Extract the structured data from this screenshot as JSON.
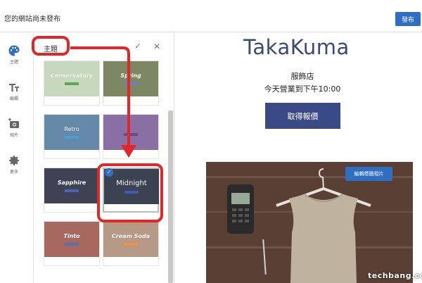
{
  "topbar": {
    "site_status": "您的網站尚未發布",
    "publish_label": "發布"
  },
  "rail": {
    "items": [
      {
        "icon": "palette-icon",
        "label": "主題"
      },
      {
        "icon": "text-format-icon",
        "label": "編輯"
      },
      {
        "icon": "add-photo-icon",
        "label": "相片"
      },
      {
        "icon": "gear-icon",
        "label": "更多"
      }
    ]
  },
  "panel": {
    "title": "主題",
    "confirm_icon": "check-icon",
    "close_icon": "close-icon",
    "themes": [
      {
        "name": "Conservatory",
        "bg": "#c7d9bc",
        "bar": "#5ea35c",
        "fg": "#ffffff",
        "selected": false
      },
      {
        "name": "Spring",
        "bg": "#7d8763",
        "bar": "#6b80c0",
        "fg": "#ffffff",
        "selected": false
      },
      {
        "name": "Retro",
        "bg": "#6589a8",
        "bar": "#4b9fd6",
        "fg": "#ffffff",
        "selected": false
      },
      {
        "name": "",
        "bg": "#8a6fa5",
        "bar": "#6a4c86",
        "fg": "#ffffff",
        "selected": false
      },
      {
        "name": "Sapphire",
        "bg": "#3f4254",
        "bar": "#4f63b4",
        "fg": "#ffffff",
        "selected": false
      },
      {
        "name": "Midnight",
        "bg": "#3b4252",
        "bar": "#3f5bb8",
        "fg": "#ffffff",
        "selected": true
      },
      {
        "name": "Tinto",
        "bg": "#a7685f",
        "bar": "#5a6fb0",
        "fg": "#ffffff",
        "selected": false
      },
      {
        "name": "Cream Soda",
        "bg": "#b69a85",
        "bar": "#f0904a",
        "fg": "#ffffff",
        "selected": false
      }
    ]
  },
  "preview": {
    "brand": "TakaKuma",
    "store_name": "服飾店",
    "store_hours": "今天營業到下午10:00",
    "quote_button": "取得報價",
    "edit_photo_button": "編輯標題相片"
  },
  "watermark": {
    "text": "techbang.com"
  },
  "colors": {
    "accent": "#2e6fc4",
    "annotation": "#e0282a",
    "brand": "#3a4a74"
  }
}
